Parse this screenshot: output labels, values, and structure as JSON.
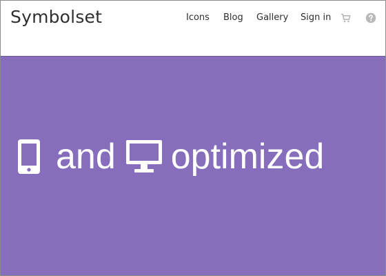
{
  "header": {
    "logo_text": "Symbolset",
    "nav": [
      {
        "label": "Icons"
      },
      {
        "label": "Blog"
      },
      {
        "label": "Gallery"
      },
      {
        "label": "Sign in"
      }
    ],
    "icons": [
      "cart-icon",
      "help-icon"
    ]
  },
  "hero": {
    "background": "#866ebc",
    "words": [
      "and",
      "optimized"
    ],
    "icons": [
      "mobile-phone-icon",
      "desktop-monitor-icon"
    ]
  },
  "colors": {
    "accent": "#866ebc",
    "nav_text": "#2e2e2e",
    "muted_icon": "#b8b8b8"
  }
}
